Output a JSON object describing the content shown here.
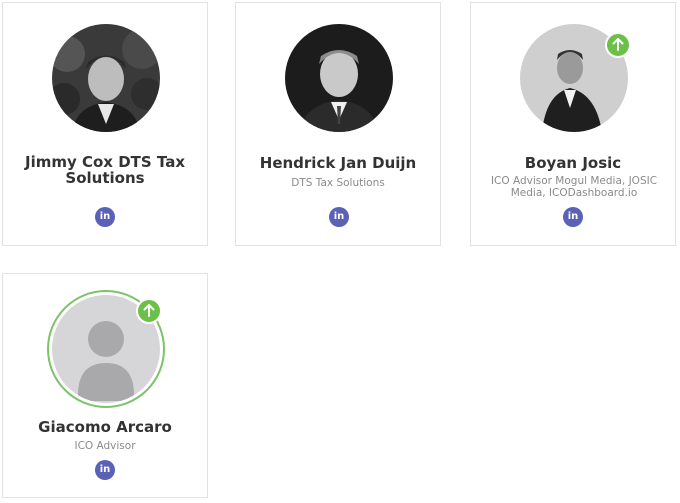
{
  "colors": {
    "linkedin": "#5b61b5",
    "online_badge": "#6cc04a",
    "name_text": "#333333",
    "role_text": "#8a8a8a"
  },
  "people": [
    {
      "name": "Jimmy Cox DTS Tax Solutions",
      "role": "",
      "linkedin_icon": "in",
      "has_badge": false
    },
    {
      "name": "Hendrick Jan Duijn",
      "role": "DTS Tax Solutions",
      "linkedin_icon": "in",
      "has_badge": false
    },
    {
      "name": "Boyan Josic",
      "role": "ICO Advisor Mogul Media, JOSIC Media, ICODashboard.io",
      "linkedin_icon": "in",
      "has_badge": true
    },
    {
      "name": "Giacomo Arcaro",
      "role": "ICO Advisor",
      "linkedin_icon": "in",
      "has_badge": true
    }
  ]
}
